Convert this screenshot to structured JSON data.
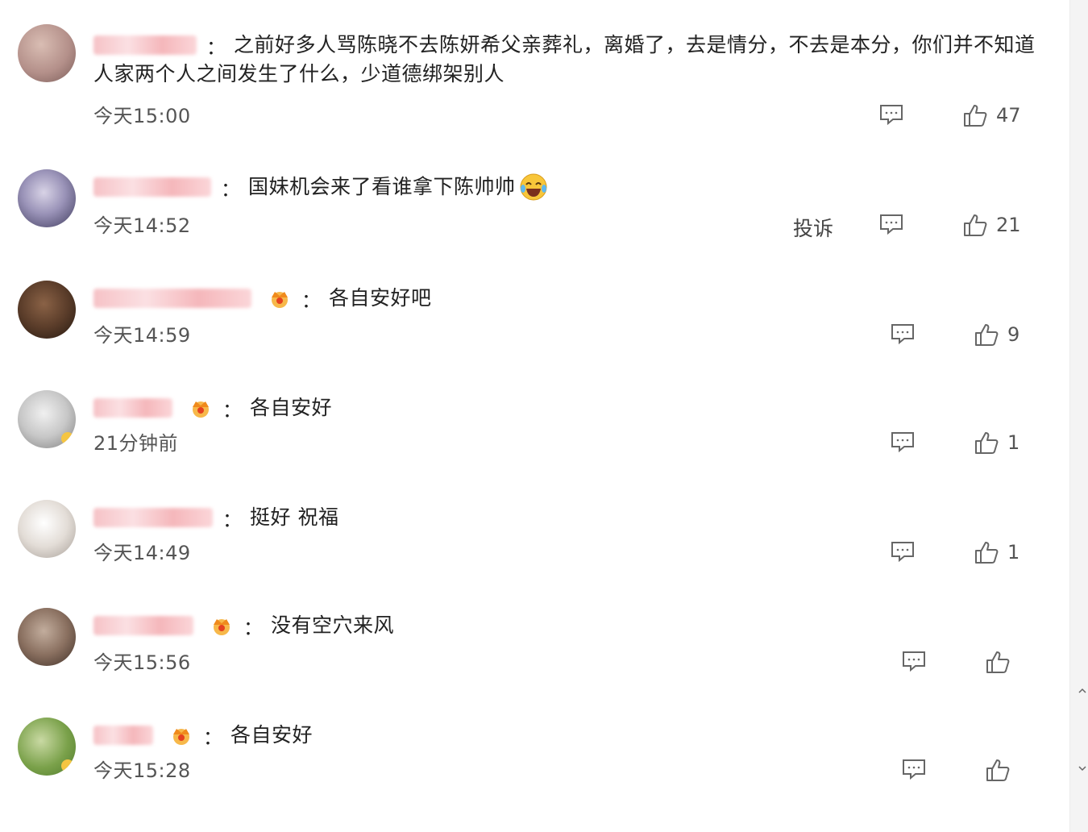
{
  "comments": [
    {
      "text_line1": "之前好多人骂陈晓不去陈妍希父亲葬礼，离婚了，去是情分，不去是本分，你们并不知道",
      "text_line2": "人家两个人之间发生了什么，少道德绑架别人",
      "time": "今天15:00",
      "likes": "47",
      "avatar_colors": [
        "#c9a69c",
        "#8f6f6a"
      ]
    },
    {
      "text": "国妹机会来了看谁拿下陈帅帅",
      "emoji": "laughing-tears-emoji",
      "time": "今天14:52",
      "report_label": "投诉",
      "likes": "21",
      "avatar_colors": [
        "#9a93b8",
        "#3e3a5c"
      ]
    },
    {
      "text": "各自安好吧",
      "time": "今天14:59",
      "likes": "9",
      "avatar_colors": [
        "#6b4a35",
        "#2c1d14"
      ]
    },
    {
      "text": "各自安好",
      "time": "21分钟前",
      "likes": "1",
      "avatar_colors": [
        "#d8d8d8",
        "#8a8a8a"
      ]
    },
    {
      "text": "挺好 祝福",
      "time": "今天14:49",
      "likes": "1",
      "avatar_colors": [
        "#e8e3de",
        "#a59d96"
      ]
    },
    {
      "text": "没有空穴来风",
      "time": "今天15:56",
      "likes": "",
      "avatar_colors": [
        "#9c8676",
        "#4a3a30"
      ]
    },
    {
      "text": "各自安好",
      "time": "今天15:28",
      "likes": "",
      "avatar_colors": [
        "#7aa14a",
        "#c9d9a3"
      ]
    }
  ],
  "colors": {
    "text": "#222222",
    "meta": "#555555",
    "icon": "#666666",
    "username_blur": "#f6c2c6",
    "crown": "#f0a020"
  },
  "icons": {
    "reply": "comment-bubble-icon",
    "like": "thumbs-up-icon",
    "crown": "vip-crown-icon"
  }
}
